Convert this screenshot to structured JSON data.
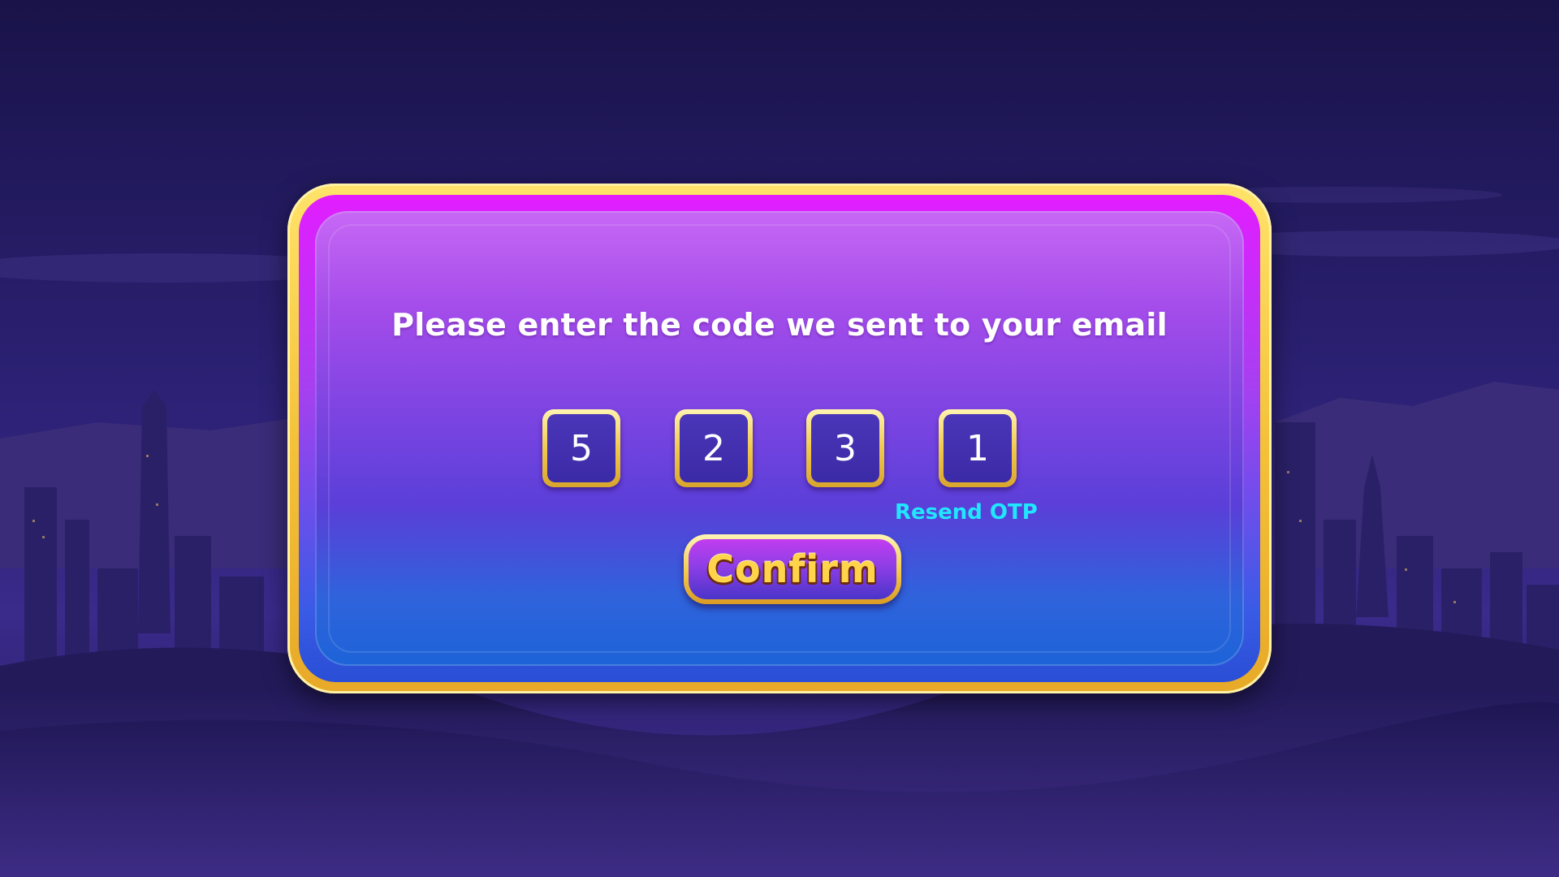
{
  "dialog": {
    "prompt": "Please enter the code we sent to your email",
    "code_digits": [
      "5",
      "2",
      "3",
      "1"
    ],
    "resend_label": "Resend OTP",
    "confirm_label": "Confirm"
  },
  "colors": {
    "frame_gold": "#f4c23a",
    "panel_top": "#c768f5",
    "panel_bottom": "#1d63d8",
    "resend_text": "#21e6ff",
    "confirm_text": "#ffd44a",
    "code_box_fill": "#3b2aa6"
  }
}
